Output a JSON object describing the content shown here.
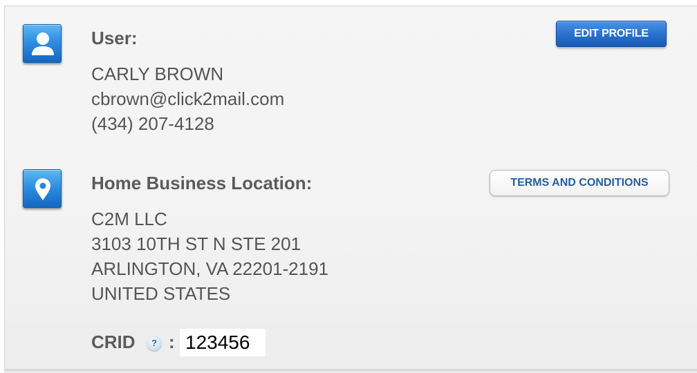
{
  "user_section": {
    "icon": "user-icon",
    "heading": "User:",
    "name": "CARLY BROWN",
    "email": "cbrown@click2mail.com",
    "phone": "(434) 207-4128",
    "edit_button_label": "EDIT PROFILE"
  },
  "location_section": {
    "icon": "location-pin-icon",
    "heading": "Home Business Location:",
    "company": "C2M LLC",
    "address_line": "3103 10TH ST N STE 201",
    "city_state_zip": "ARLINGTON, VA 22201-2191",
    "country": "UNITED STATES",
    "terms_button_label": "TERMS AND CONDITIONS"
  },
  "crid": {
    "label": "CRID",
    "help_icon": "help-question-icon",
    "help_glyph": "?",
    "separator": ":",
    "value": "123456"
  },
  "colors": {
    "primary_button": "#2a72cf",
    "secondary_button_text": "#255f9e",
    "icon_tile": "#2f8fe0",
    "text": "#555555"
  }
}
